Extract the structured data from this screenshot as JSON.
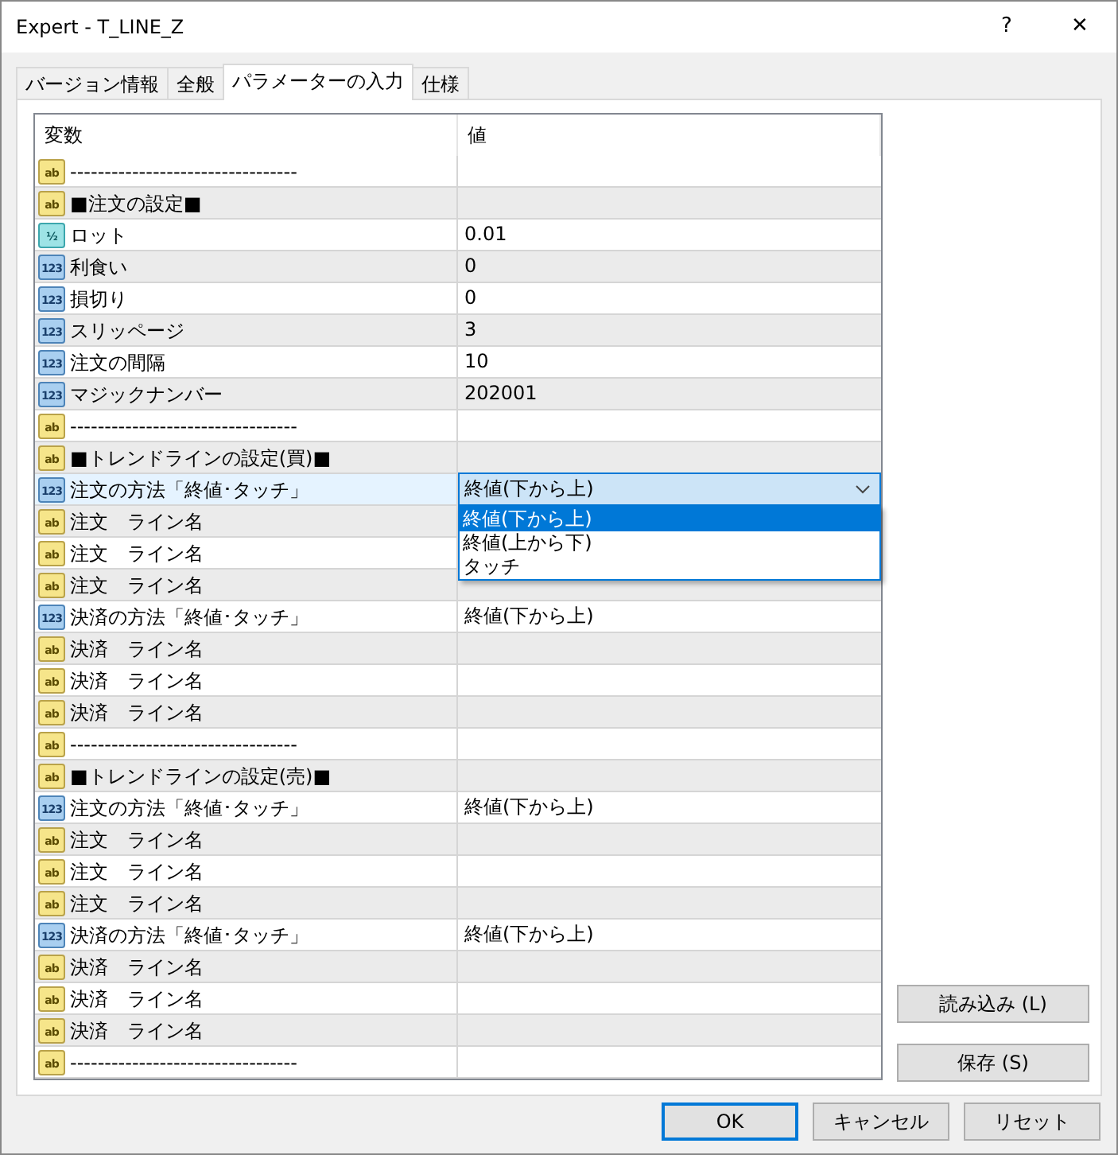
{
  "window": {
    "title": "Expert - T_LINE_Z",
    "help": "?",
    "close": "✕"
  },
  "tabs": [
    {
      "label": "バージョン情報",
      "selected": false
    },
    {
      "label": "全般",
      "selected": false
    },
    {
      "label": "パラメーターの入力",
      "selected": true
    },
    {
      "label": "仕様",
      "selected": false
    }
  ],
  "table": {
    "columns": [
      "変数",
      "値"
    ],
    "rows": [
      {
        "kind": "string",
        "icon_text": "ab",
        "name": "---------------------------------",
        "selected": false
      },
      {
        "kind": "string",
        "icon_text": "ab",
        "name": "■注文の設定■",
        "selected": false
      },
      {
        "kind": "double",
        "icon_text": "½",
        "name": "ロット",
        "value": "0.01",
        "selected": false
      },
      {
        "kind": "integer",
        "icon_text": "123",
        "name": "利食い",
        "value": "0",
        "selected": false
      },
      {
        "kind": "integer",
        "icon_text": "123",
        "name": "損切り",
        "value": "0",
        "selected": false
      },
      {
        "kind": "integer",
        "icon_text": "123",
        "name": "スリッページ",
        "value": "3",
        "selected": false
      },
      {
        "kind": "integer",
        "icon_text": "123",
        "name": "注文の間隔",
        "value": "10",
        "selected": false
      },
      {
        "kind": "integer",
        "icon_text": "123",
        "name": "マジックナンバー",
        "value": "202001",
        "selected": false
      },
      {
        "kind": "string",
        "icon_text": "ab",
        "name": "---------------------------------",
        "selected": false
      },
      {
        "kind": "string",
        "icon_text": "ab",
        "name": "■トレンドラインの設定(買)■",
        "selected": false
      },
      {
        "kind": "integer",
        "icon_text": "123",
        "name": "注文の方法「終値･タッチ」",
        "selected": true,
        "dropdown": {
          "value": "終値(下から上)",
          "expanded": true,
          "options": [
            {
              "label": "終値(下から上)",
              "selected": true
            },
            {
              "label": "終値(上から下)",
              "selected": false
            },
            {
              "label": "タッチ",
              "selected": false
            }
          ]
        }
      },
      {
        "kind": "string",
        "icon_text": "ab",
        "name": "注文　ライン名",
        "selected": false
      },
      {
        "kind": "string",
        "icon_text": "ab",
        "name": "注文　ライン名",
        "selected": false
      },
      {
        "kind": "string",
        "icon_text": "ab",
        "name": "注文　ライン名",
        "selected": false
      },
      {
        "kind": "integer",
        "icon_text": "123",
        "name": "決済の方法「終値･タッチ」",
        "value": "終値(下から上)",
        "selected": false
      },
      {
        "kind": "string",
        "icon_text": "ab",
        "name": "決済　ライン名",
        "selected": false
      },
      {
        "kind": "string",
        "icon_text": "ab",
        "name": "決済　ライン名",
        "selected": false
      },
      {
        "kind": "string",
        "icon_text": "ab",
        "name": "決済　ライン名",
        "selected": false
      },
      {
        "kind": "string",
        "icon_text": "ab",
        "name": "---------------------------------",
        "selected": false
      },
      {
        "kind": "string",
        "icon_text": "ab",
        "name": "■トレンドラインの設定(売)■",
        "selected": false
      },
      {
        "kind": "integer",
        "icon_text": "123",
        "name": "注文の方法「終値･タッチ」",
        "value": "終値(下から上)",
        "selected": false
      },
      {
        "kind": "string",
        "icon_text": "ab",
        "name": "注文　ライン名",
        "selected": false
      },
      {
        "kind": "string",
        "icon_text": "ab",
        "name": "注文　ライン名",
        "selected": false
      },
      {
        "kind": "string",
        "icon_text": "ab",
        "name": "注文　ライン名",
        "selected": false
      },
      {
        "kind": "integer",
        "icon_text": "123",
        "name": "決済の方法「終値･タッチ」",
        "value": "終値(下から上)",
        "selected": false
      },
      {
        "kind": "string",
        "icon_text": "ab",
        "name": "決済　ライン名",
        "selected": false
      },
      {
        "kind": "string",
        "icon_text": "ab",
        "name": "決済　ライン名",
        "selected": false
      },
      {
        "kind": "string",
        "icon_text": "ab",
        "name": "決済　ライン名",
        "selected": false
      },
      {
        "kind": "string",
        "icon_text": "ab",
        "name": "---------------------------------",
        "selected": false
      }
    ]
  },
  "side_buttons": [
    "読み込み (L)",
    "保存 (S)"
  ],
  "buttons": [
    {
      "label": "OK",
      "focused": true
    },
    {
      "label": "キャンセル",
      "focused": false
    },
    {
      "label": "リセット",
      "focused": false
    }
  ]
}
